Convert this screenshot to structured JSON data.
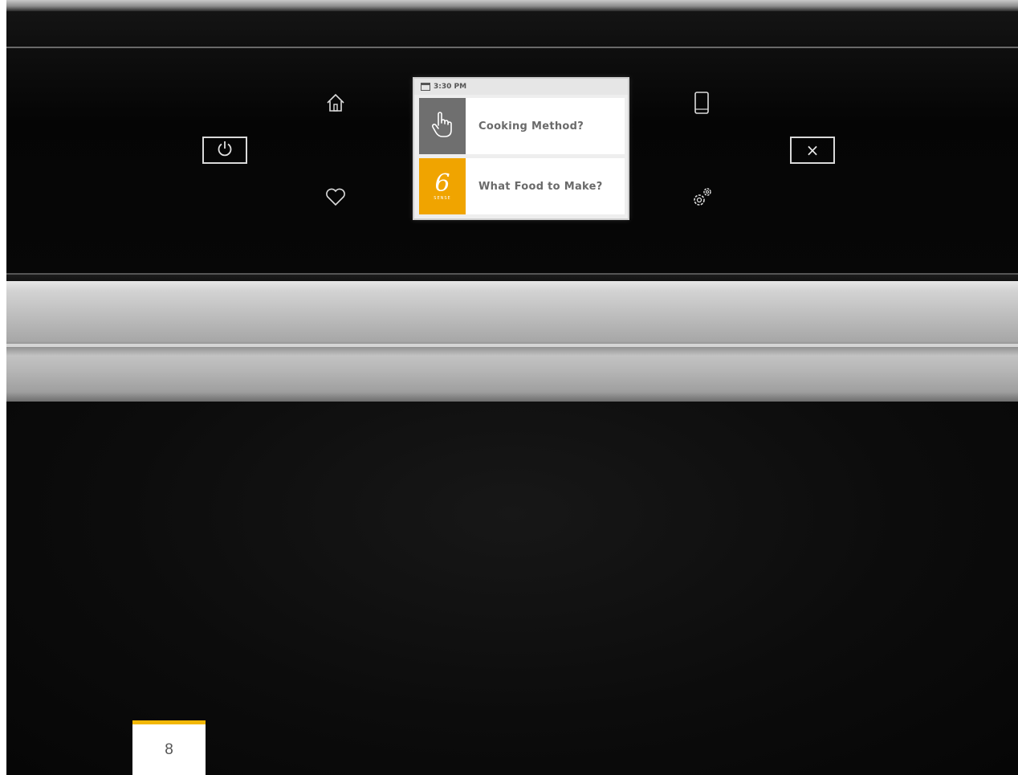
{
  "display": {
    "status_time": "3:30 PM",
    "items": [
      {
        "label": "Cooking Method?",
        "icon": "hand-pointer-icon",
        "tile_color": "#6f6f6f"
      },
      {
        "label": "What Food to Make?",
        "icon": "sixth-sense-icon",
        "tile_color": "#f0a400",
        "tile_number": "6",
        "tile_word": "SENSE"
      }
    ]
  },
  "controls": {
    "power_icon": "power-icon",
    "home_icon": "home-icon",
    "favorite_icon": "heart-icon",
    "mobile_icon": "phone-icon",
    "settings_icon": "gear-icon",
    "close_label": "×"
  },
  "page": {
    "number": "8",
    "accent_color": "#f2b705"
  },
  "colors": {
    "panel": "#050505",
    "display_bg": "#ffffff",
    "icon_stroke": "#dcdcdc"
  }
}
